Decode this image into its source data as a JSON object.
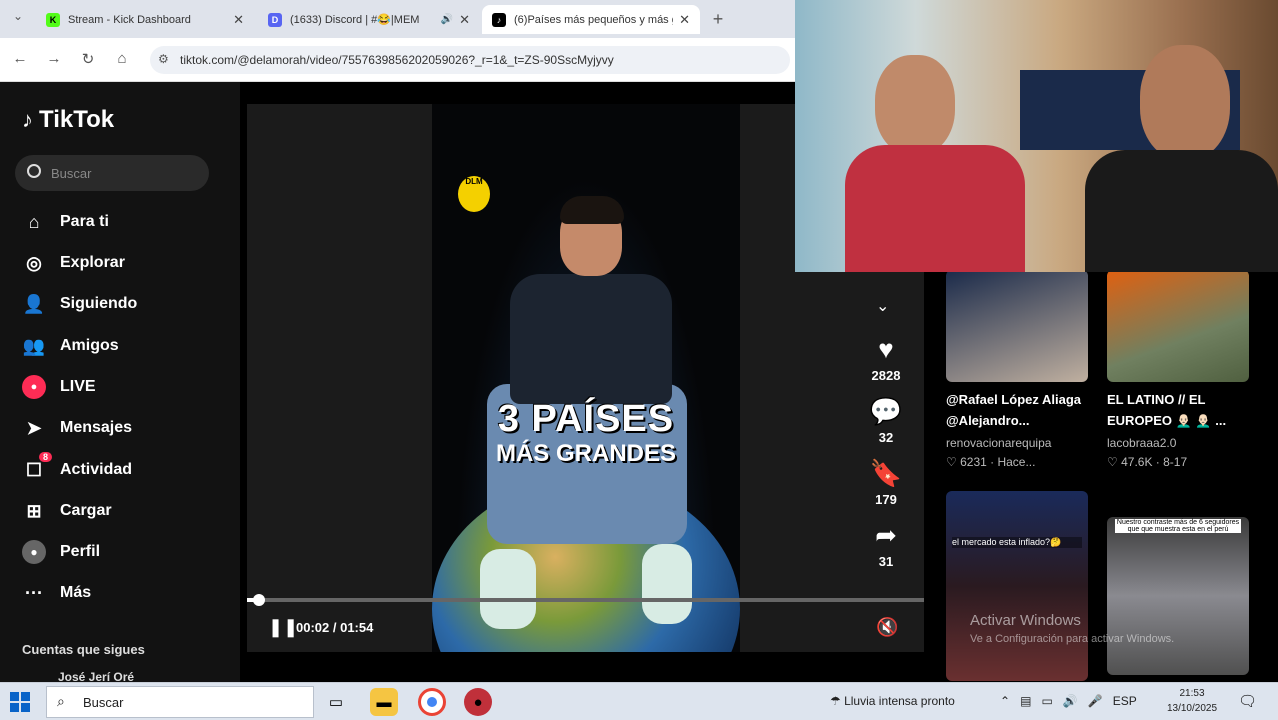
{
  "browser": {
    "tabs": [
      {
        "title": "Stream - Kick Dashboard",
        "active": false
      },
      {
        "title": "(1633) Discord | #😂|MEM",
        "active": false
      },
      {
        "title": "(6)Países más pequeños y más g",
        "active": true
      }
    ],
    "new_tab": "+",
    "url": "tiktok.com/@delamorah/video/7557639856202059026?_r=1&_t=ZS-90SscMyjyvy"
  },
  "tiktok": {
    "logo": "TikTok",
    "search_placeholder": "Buscar",
    "nav": [
      {
        "label": "Para ti",
        "icon": "home-icon"
      },
      {
        "label": "Explorar",
        "icon": "compass-icon"
      },
      {
        "label": "Siguiendo",
        "icon": "user-follow-icon"
      },
      {
        "label": "Amigos",
        "icon": "friends-icon"
      },
      {
        "label": "LIVE",
        "icon": "live-icon"
      },
      {
        "label": "Mensajes",
        "icon": "send-icon"
      },
      {
        "label": "Actividad",
        "icon": "inbox-icon",
        "badge": "8"
      },
      {
        "label": "Cargar",
        "icon": "upload-icon"
      },
      {
        "label": "Perfil",
        "icon": "avatar-icon"
      },
      {
        "label": "Más",
        "icon": "more-icon"
      }
    ],
    "following_header": "Cuentas que sigues",
    "following_first": "José Jerí Oré"
  },
  "video": {
    "caption_line1": "3 PAÍSES",
    "caption_line2": "MÁS GRANDES",
    "logo_text": "DLM",
    "time": "00:02 / 01:54",
    "progress": 0.017,
    "author": "delamorah"
  },
  "actions": {
    "likes": "2828",
    "comments": "32",
    "saves": "179",
    "shares": "31"
  },
  "related": [
    {
      "title": "@Rafael López Aliaga @Alejandro...",
      "author": "renovacionarequipa",
      "meta": "♡ 6231 · Hace..."
    },
    {
      "title": "EL LATINO // EL EUROPEO 👨🏻‍🦲 👨🏻‍🦲 ...",
      "author": "lacobraaa2.0",
      "meta": "♡ 47.6K · 8-17"
    },
    {
      "thumb_text": "el mercado esta inflado?🤔"
    },
    {
      "thumb_text": "Nuestro contraste más de 6 seguidores que que muestra esta en el perú"
    }
  ],
  "watermark": {
    "line1": "Activar Windows",
    "line2": "Ve a Configuración para activar Windows."
  },
  "taskbar": {
    "search": "Buscar",
    "weather": "Lluvia intensa pronto",
    "lang": "ESP",
    "time": "21:53",
    "date": "13/10/2025"
  }
}
